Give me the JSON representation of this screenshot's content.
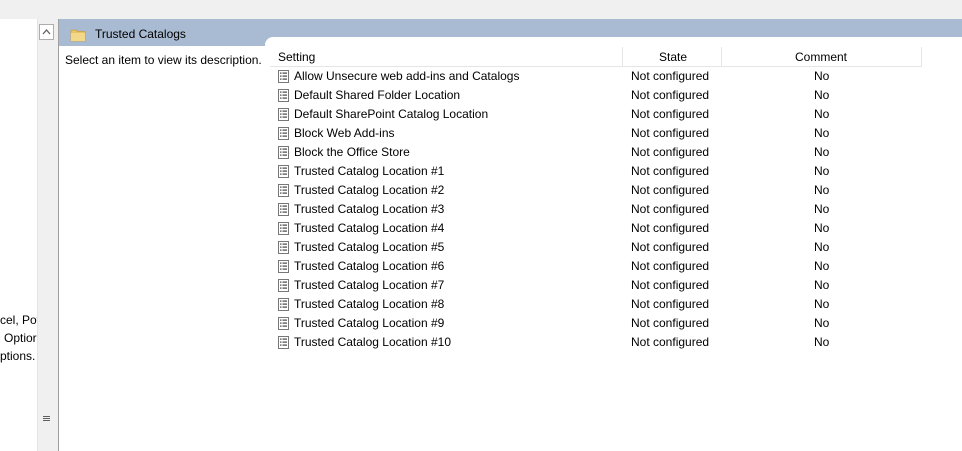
{
  "left_pane": {
    "lines": [
      "cel, Pov",
      "Optior",
      "ptions."
    ]
  },
  "header": {
    "title": "Trusted Catalogs"
  },
  "description": {
    "text": "Select an item to view its description."
  },
  "columns": {
    "setting": "Setting",
    "state": "State",
    "comment": "Comment"
  },
  "rows": [
    {
      "name": "Allow Unsecure web add-ins and Catalogs",
      "state": "Not configured",
      "comment": "No"
    },
    {
      "name": "Default Shared Folder Location",
      "state": "Not configured",
      "comment": "No"
    },
    {
      "name": "Default SharePoint Catalog Location",
      "state": "Not configured",
      "comment": "No"
    },
    {
      "name": "Block Web Add-ins",
      "state": "Not configured",
      "comment": "No"
    },
    {
      "name": "Block the Office Store",
      "state": "Not configured",
      "comment": "No"
    },
    {
      "name": "Trusted Catalog Location #1",
      "state": "Not configured",
      "comment": "No"
    },
    {
      "name": "Trusted Catalog Location #2",
      "state": "Not configured",
      "comment": "No"
    },
    {
      "name": "Trusted Catalog Location #3",
      "state": "Not configured",
      "comment": "No"
    },
    {
      "name": "Trusted Catalog Location #4",
      "state": "Not configured",
      "comment": "No"
    },
    {
      "name": "Trusted Catalog Location #5",
      "state": "Not configured",
      "comment": "No"
    },
    {
      "name": "Trusted Catalog Location #6",
      "state": "Not configured",
      "comment": "No"
    },
    {
      "name": "Trusted Catalog Location #7",
      "state": "Not configured",
      "comment": "No"
    },
    {
      "name": "Trusted Catalog Location #8",
      "state": "Not configured",
      "comment": "No"
    },
    {
      "name": "Trusted Catalog Location #9",
      "state": "Not configured",
      "comment": "No"
    },
    {
      "name": "Trusted Catalog Location #10",
      "state": "Not configured",
      "comment": "No"
    }
  ],
  "colors": {
    "header_bar": "#a9bbd2",
    "folder": "#e8c468"
  }
}
